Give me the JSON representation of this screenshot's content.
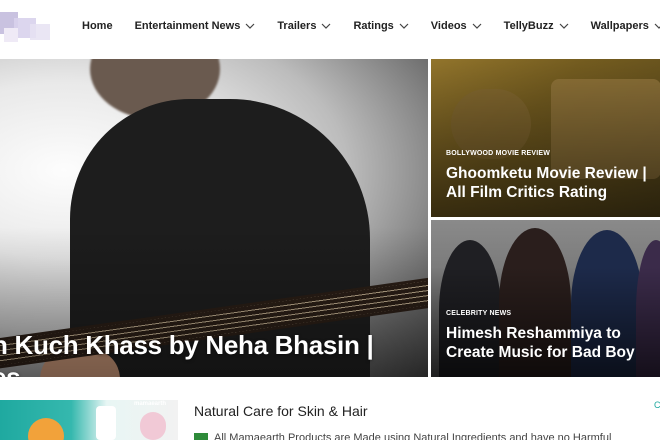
{
  "nav": {
    "items": [
      {
        "label": "Home",
        "dropdown": false
      },
      {
        "label": "Entertainment News",
        "dropdown": true
      },
      {
        "label": "Trailers",
        "dropdown": true
      },
      {
        "label": "Ratings",
        "dropdown": true
      },
      {
        "label": "Videos",
        "dropdown": true
      },
      {
        "label": "TellyBuzz",
        "dropdown": true
      },
      {
        "label": "Wallpapers",
        "dropdown": true
      }
    ]
  },
  "hero": {
    "title_line1": "h Kuch Khass by Neha Bhasin |",
    "title_line2": "es"
  },
  "cards": [
    {
      "category": "BOLLYWOOD MOVIE REVIEW",
      "title_line1": "Ghoomketu Movie Review |",
      "title_line2": "All Film Critics Rating"
    },
    {
      "category": "CELEBRITY NEWS",
      "title_line1": "Himesh Reshammiya to",
      "title_line2": "Create Music for Bad Boy"
    }
  ],
  "ad": {
    "brand": "mamaearth",
    "title": "Natural Care for Skin & Hair",
    "description": "All Mamaearth Products are Made using Natural Ingredients and have no Harmful",
    "corner": "C"
  },
  "colors": {
    "accent": "#2e8b3a",
    "nav_text": "#222222"
  }
}
